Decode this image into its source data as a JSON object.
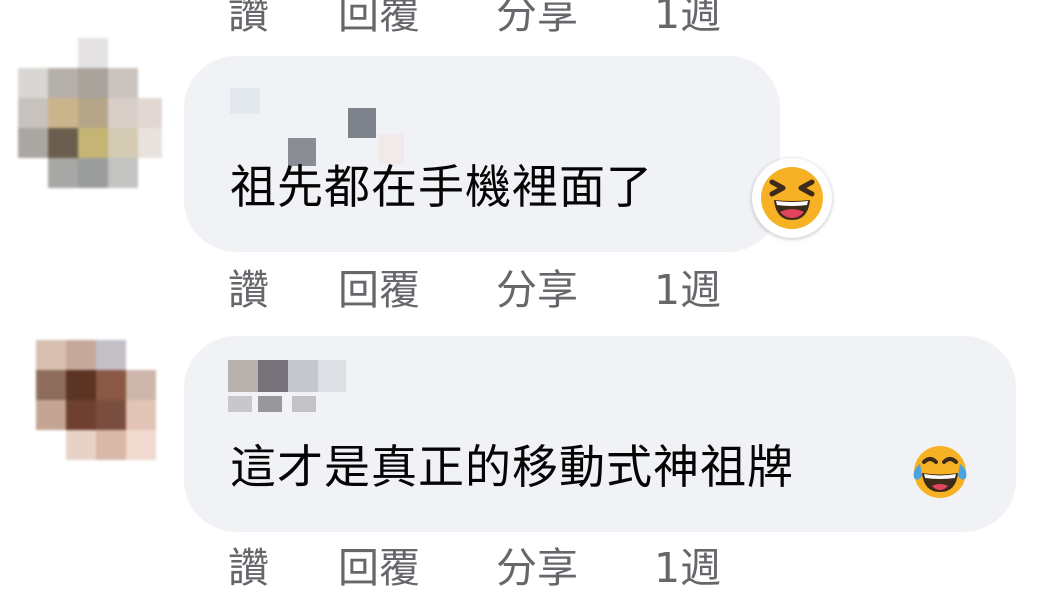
{
  "actions": {
    "like": "讚",
    "reply": "回覆",
    "share": "分享",
    "time": "1週"
  },
  "comments": [
    {
      "author": "",
      "text": "祖先都在手機裡面了",
      "reaction_icon": "laughing-face-icon"
    },
    {
      "author": "",
      "text": "這才是真正的移動式神祖牌",
      "inline_emoji": "tears-of-joy-icon"
    }
  ],
  "colors": {
    "bubble": "#f0f2f5",
    "text": "#050505",
    "meta": "#65676b",
    "emoji": "#f7b125"
  }
}
